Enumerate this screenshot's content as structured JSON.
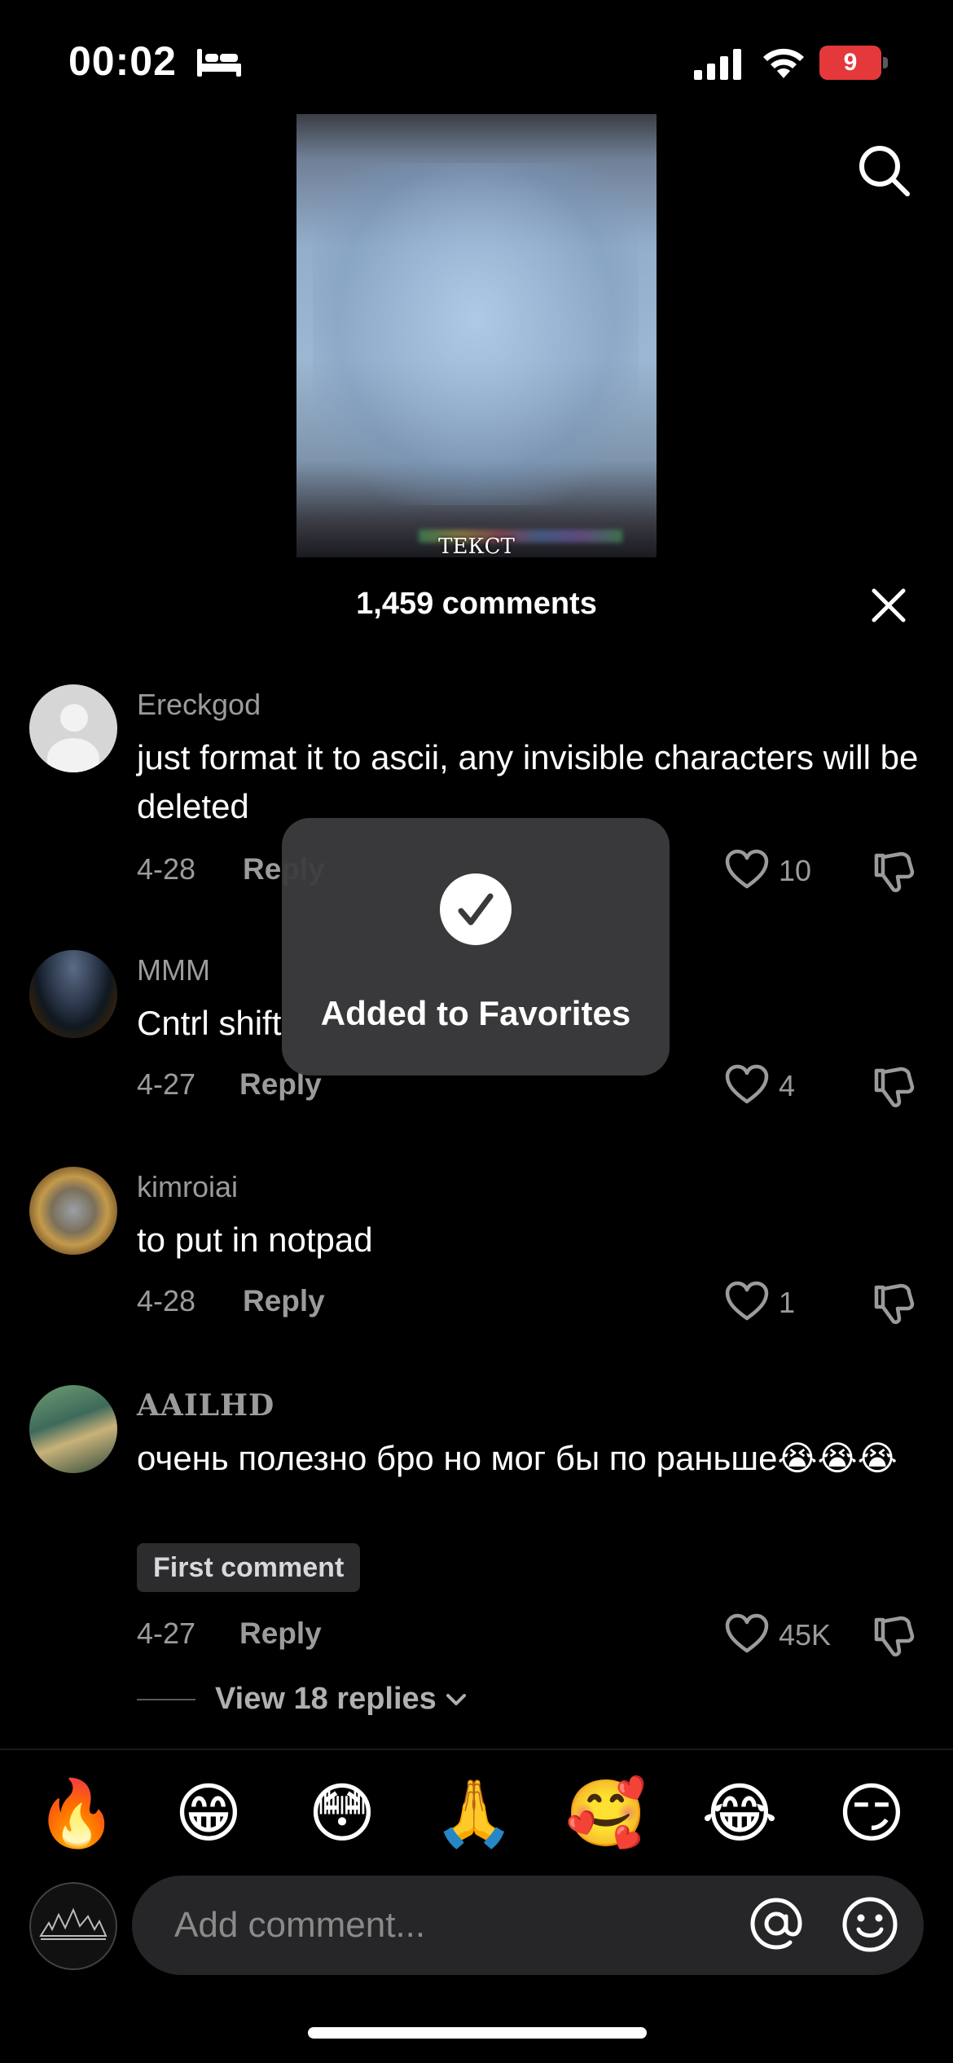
{
  "status_bar": {
    "time": "00:02",
    "battery_percent": "9"
  },
  "video": {
    "caption": "ТЕКСТ"
  },
  "header": {
    "comments_count": "1,459 comments"
  },
  "comments": [
    {
      "username": "Ereckgod",
      "text": "just format it to ascii, any invisible characters will be deleted",
      "date": "4-28",
      "reply": "Reply",
      "likes": "10"
    },
    {
      "username": "MMM",
      "text": "Cntrl shift",
      "date": "4-27",
      "reply": "Reply",
      "likes": "4"
    },
    {
      "username": "kimroiai",
      "text": "to put in notpad",
      "date": "4-28",
      "reply": "Reply",
      "likes": "1"
    },
    {
      "username": "AAILHD",
      "text": "очень полезно бро но мог бы по раньше😭😭😭",
      "badge": "First comment",
      "date": "4-27",
      "reply": "Reply",
      "likes": "45K",
      "view_replies": "View 18 replies"
    }
  ],
  "toast": {
    "message": "Added to Favorites"
  },
  "emoji_bar": [
    "🔥",
    "😁",
    "😳",
    "🙏",
    "🥰",
    "😂",
    "😏"
  ],
  "input": {
    "placeholder": "Add comment..."
  },
  "colors": {
    "background": "#000000",
    "secondary_text": "#9b9b9b",
    "battery_low": "#e5383b",
    "input_bg": "#262628"
  }
}
